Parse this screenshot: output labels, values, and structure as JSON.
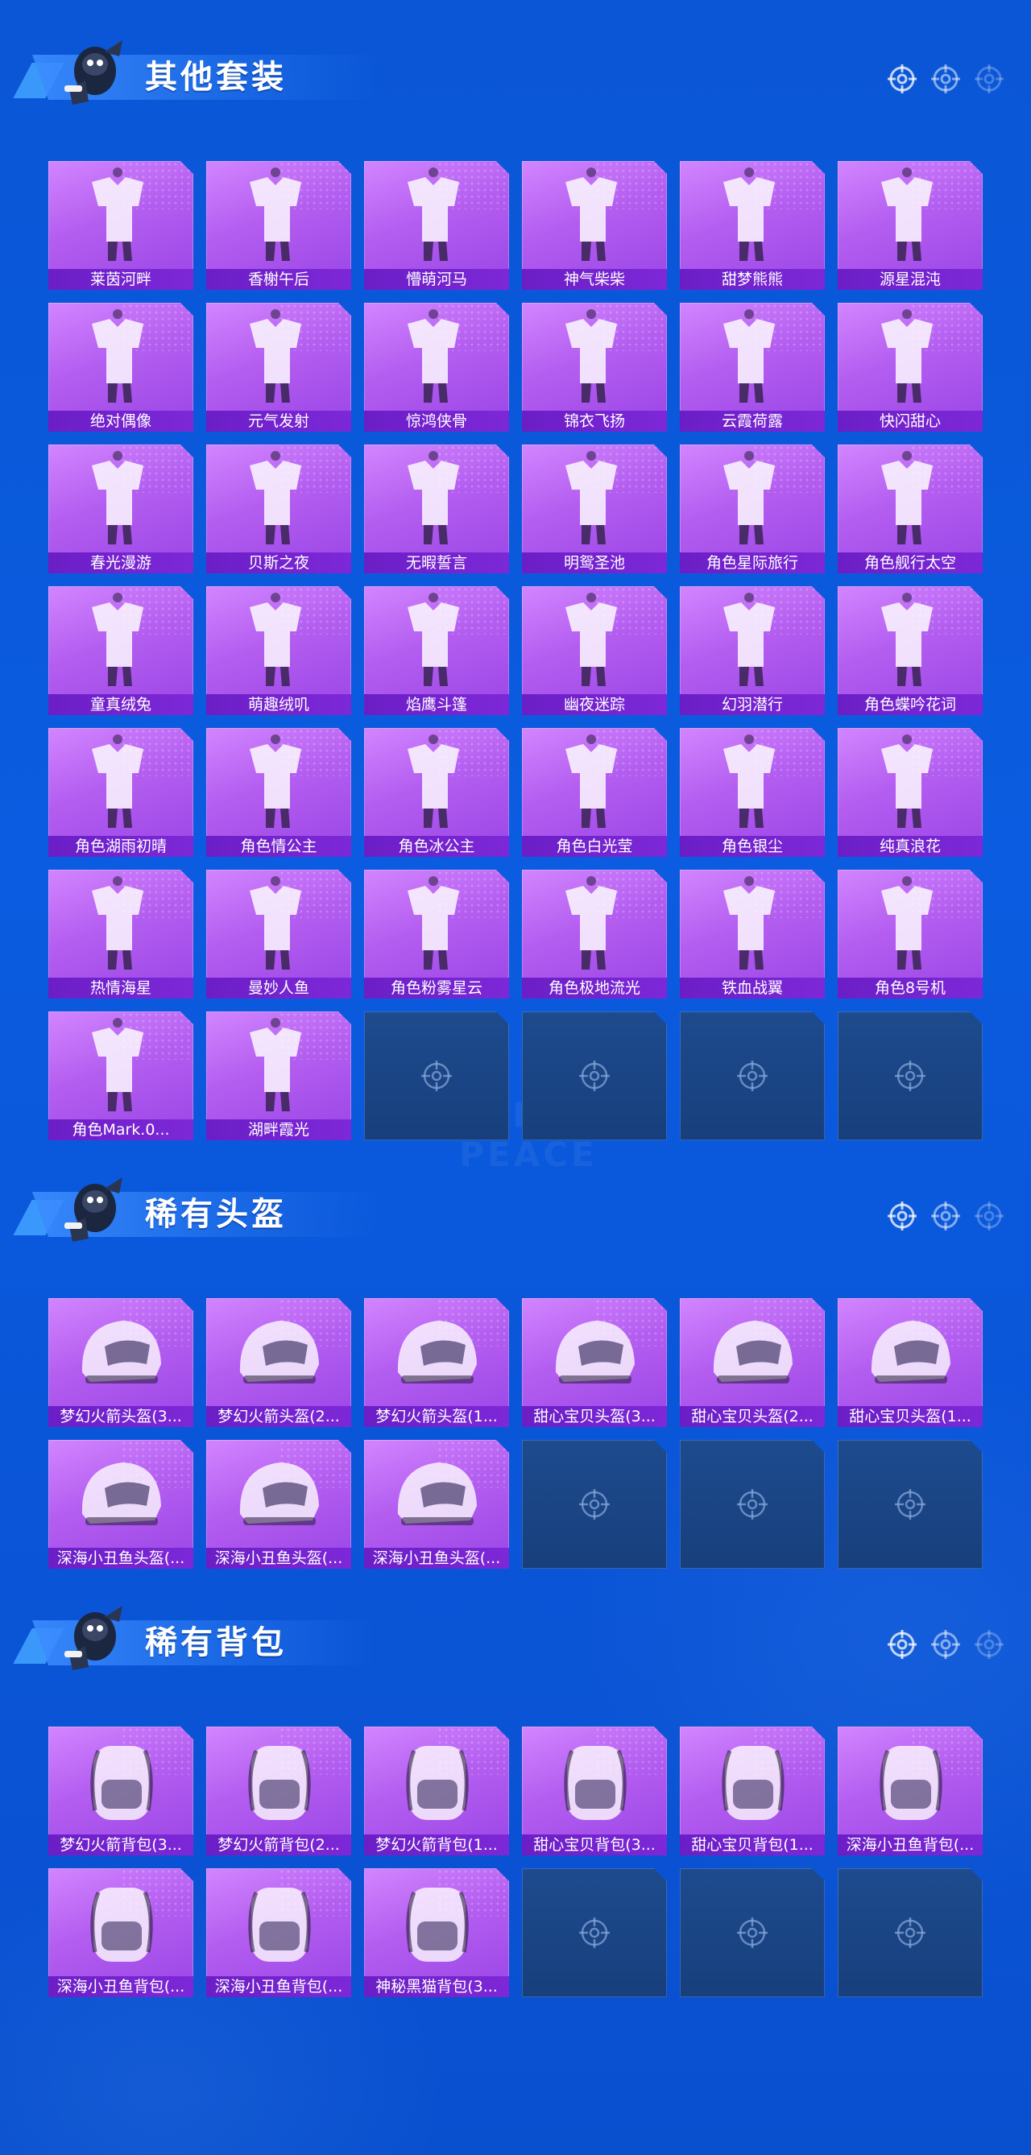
{
  "watermark": "GAME FOR PEACE",
  "icons": {
    "crosshair": "crosshair-icon",
    "mascot": "mascot-icon"
  },
  "colors": {
    "card": "#b35df0",
    "label_bar": "#6b1ec6",
    "empty_slot": "#1d4b8e",
    "background": "#0b5ce0"
  },
  "sections": [
    {
      "title": "其他套装",
      "items": [
        "莱茵河畔",
        "香榭午后",
        "懵萌河马",
        "神气柴柴",
        "甜梦熊熊",
        "源星混沌",
        "绝对偶像",
        "元气发射",
        "惊鸿侠骨",
        "锦衣飞扬",
        "云霞荷露",
        "快闪甜心",
        "春光漫游",
        "贝斯之夜",
        "无暇誓言",
        "明鸳圣池",
        "角色星际旅行",
        "角色舰行太空",
        "童真绒兔",
        "萌趣绒叽",
        "焰鹰斗篷",
        "幽夜迷踪",
        "幻羽潜行",
        "角色蝶吟花词",
        "角色湖雨初晴",
        "角色情公主",
        "角色冰公主",
        "角色白光莹",
        "角色银尘",
        "纯真浪花",
        "热情海星",
        "曼妙人鱼",
        "角色粉雾星云",
        "角色极地流光",
        "铁血战翼",
        "角色8号机",
        "角色Mark.0...",
        "湖畔霞光"
      ],
      "empty_slots": 4
    },
    {
      "title": "稀有头盔",
      "items": [
        "梦幻火箭头盔(3...",
        "梦幻火箭头盔(2...",
        "梦幻火箭头盔(1...",
        "甜心宝贝头盔(3...",
        "甜心宝贝头盔(2...",
        "甜心宝贝头盔(1...",
        "深海小丑鱼头盔(...",
        "深海小丑鱼头盔(...",
        "深海小丑鱼头盔(..."
      ],
      "empty_slots": 3
    },
    {
      "title": "稀有背包",
      "items": [
        "梦幻火箭背包(3...",
        "梦幻火箭背包(2...",
        "梦幻火箭背包(1...",
        "甜心宝贝背包(3...",
        "甜心宝贝背包(1...",
        "深海小丑鱼背包(...",
        "深海小丑鱼背包(...",
        "深海小丑鱼背包(...",
        "神秘黑猫背包(3..."
      ],
      "empty_slots": 3
    }
  ]
}
